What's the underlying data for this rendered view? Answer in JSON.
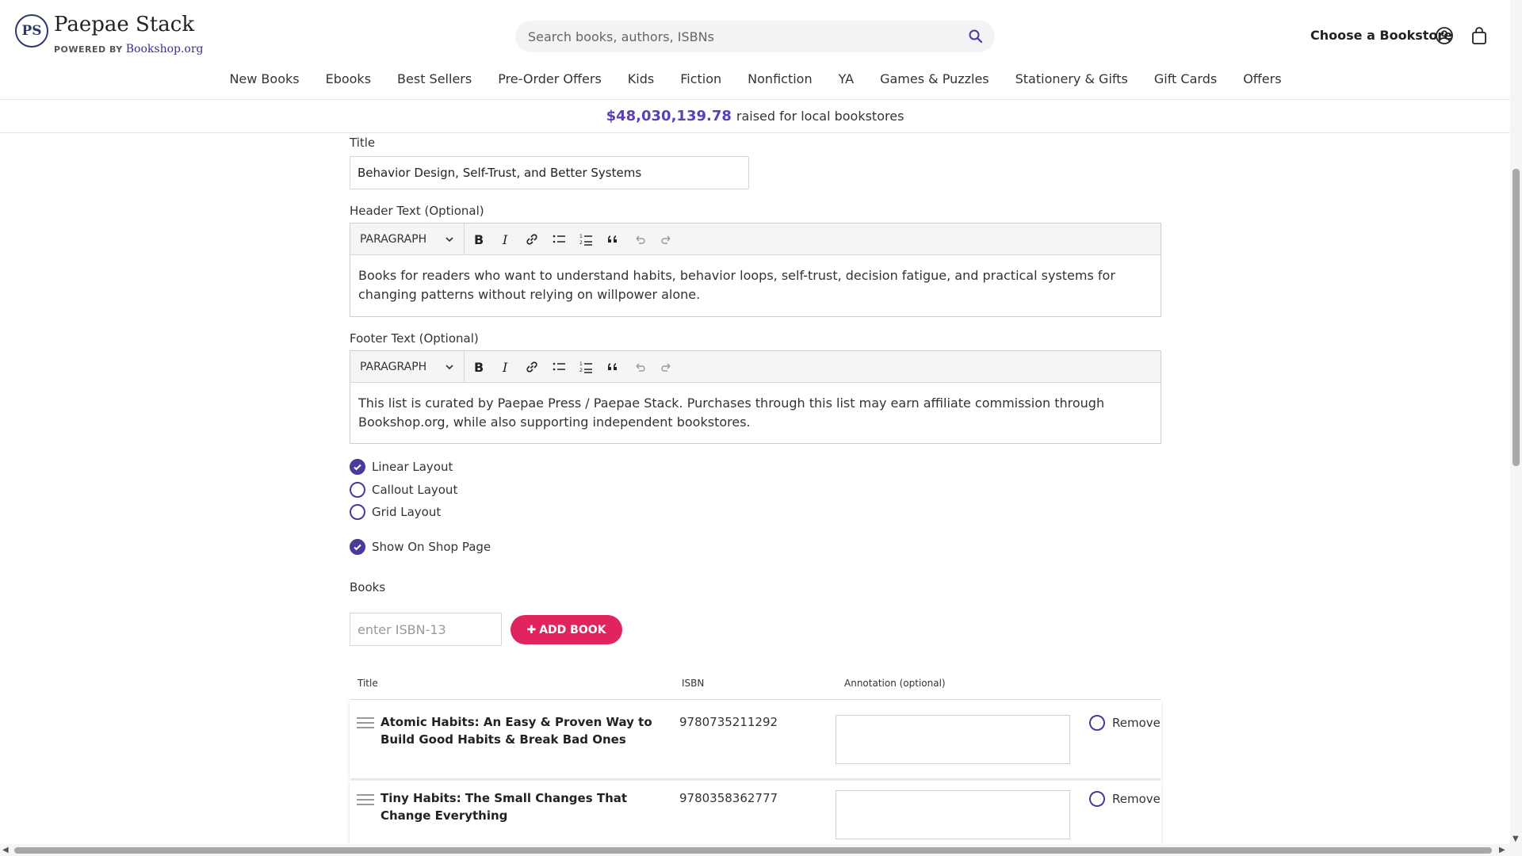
{
  "header": {
    "logo_text": "PS",
    "brand_name": "Paepae Stack",
    "powered_by": "POWERED BY",
    "powered_brand": "Bookshop.org",
    "search_placeholder": "Search books, authors, ISBNs",
    "choose_bookstore": "Choose a Bookstore"
  },
  "nav": [
    "New Books",
    "Ebooks",
    "Best Sellers",
    "Pre-Order Offers",
    "Kids",
    "Fiction",
    "Nonfiction",
    "YA",
    "Games & Puzzles",
    "Stationery & Gifts",
    "Gift Cards",
    "Offers"
  ],
  "banner": {
    "amount": "$48,030,139.78",
    "text": "raised for local bookstores"
  },
  "form": {
    "title_label": "Title",
    "title_value": "Behavior Design, Self-Trust, and Better Systems",
    "header_label": "Header Text (Optional)",
    "header_text": "Books for readers who want to understand habits, behavior loops, self-trust, decision fatigue, and practical systems for changing patterns without relying on willpower alone.",
    "footer_label": "Footer Text (Optional)",
    "footer_text": "This list is curated by Paepae Press / Paepae Stack. Purchases through this list may earn affiliate commission through Bookshop.org, while also supporting independent bookstores.",
    "paragraph_label": "PARAGRAPH",
    "layouts": [
      {
        "label": "Linear Layout",
        "checked": true
      },
      {
        "label": "Callout Layout",
        "checked": false
      },
      {
        "label": "Grid Layout",
        "checked": false
      }
    ],
    "show_on_shop": "Show On Shop Page",
    "books_label": "Books",
    "isbn_placeholder": "enter ISBN-13",
    "add_book": "ADD BOOK"
  },
  "table": {
    "headers": [
      "Title",
      "ISBN",
      "Annotation (optional)"
    ],
    "remove_label": "Remove",
    "rows": [
      {
        "title": "Atomic Habits: An Easy & Proven Way to Build Good Habits & Break Bad Ones",
        "isbn": "9780735211292"
      },
      {
        "title": "Tiny Habits: The Small Changes That Change Everything",
        "isbn": "9780358362777"
      }
    ]
  },
  "colors": {
    "accent": "#4a3a9a",
    "add_button": "#e0245e",
    "amount": "#5b3fb8"
  }
}
